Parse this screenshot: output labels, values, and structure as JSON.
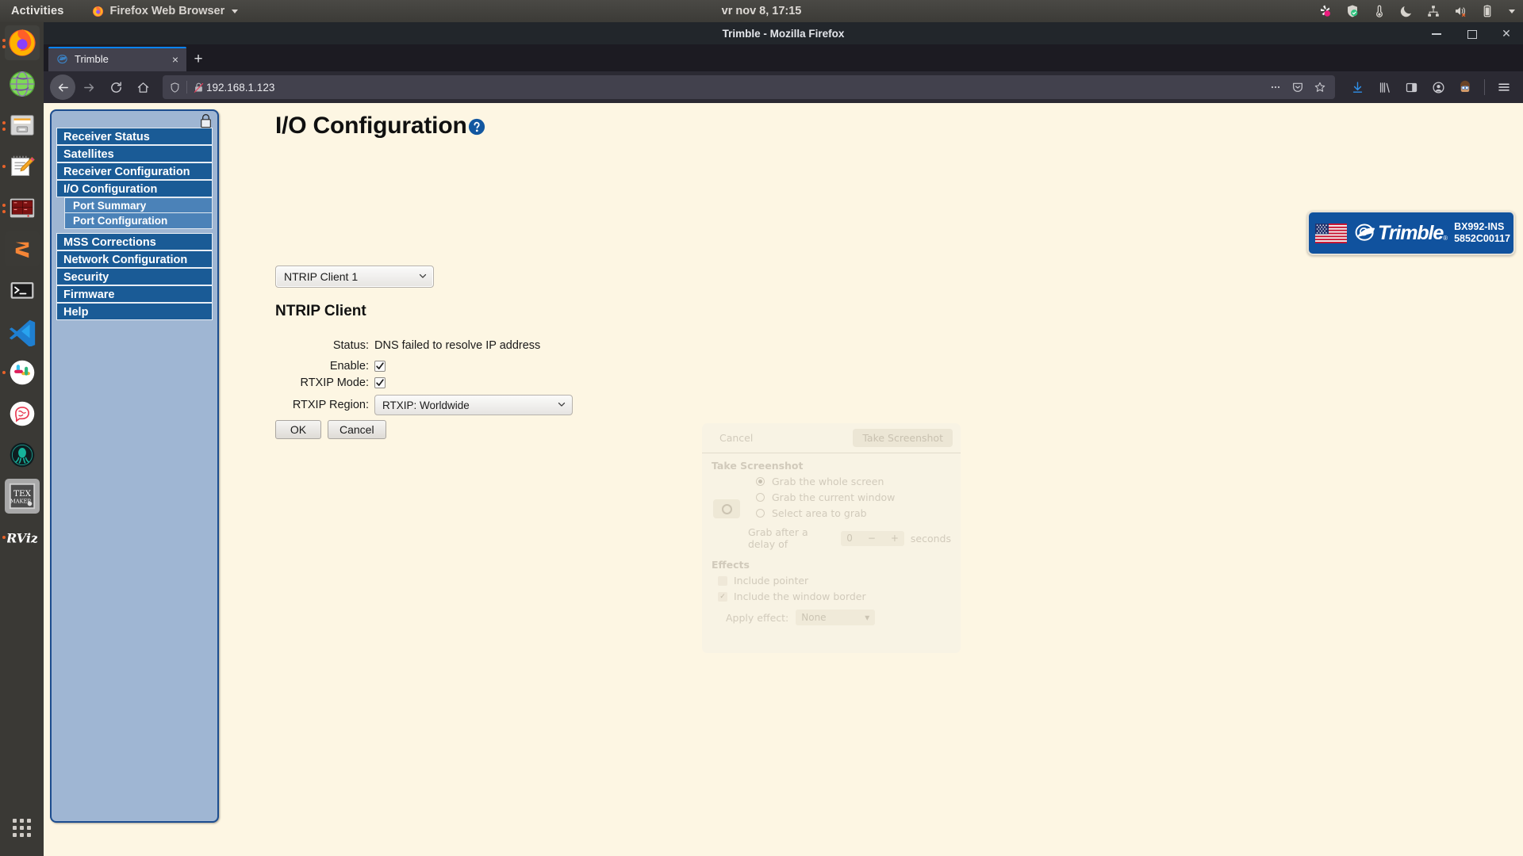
{
  "desktop": {
    "activities_label": "Activities",
    "app_menu_label": "Firefox Web Browser",
    "clock": "vr nov  8, 17:15",
    "tray_icons": [
      "screen-record-icon",
      "shield-check-icon",
      "thermometer-icon",
      "night-light-moon-icon",
      "network-wired-icon",
      "speaker-muted-icon",
      "battery-icon",
      "system-menu-caret-icon"
    ],
    "dock_items": [
      {
        "name": "firefox",
        "running": true,
        "active": true
      },
      {
        "name": "globe-browser",
        "running": false,
        "active": false
      },
      {
        "name": "file-cabinet",
        "running": true,
        "active": false
      },
      {
        "name": "notes-editor",
        "running": true,
        "active": false
      },
      {
        "name": "terminal-grid",
        "running": true,
        "active": false
      },
      {
        "name": "sublime-text",
        "running": false,
        "active": false
      },
      {
        "name": "terminal",
        "running": false,
        "active": false
      },
      {
        "name": "vs-code",
        "running": false,
        "active": false
      },
      {
        "name": "slack",
        "running": true,
        "active": false
      },
      {
        "name": "brain-chat",
        "running": false,
        "active": false
      },
      {
        "name": "squid-dark",
        "running": false,
        "active": false
      },
      {
        "name": "texmaker",
        "running": false,
        "active": false
      },
      {
        "name": "rviz",
        "running": true,
        "active": false
      }
    ],
    "apps_grid_label": "Show Applications"
  },
  "browser": {
    "window_title": "Trimble - Mozilla Firefox",
    "tab": {
      "title": "Trimble",
      "close_label": "×"
    },
    "new_tab_label": "+",
    "window_controls": {
      "minimize": "minimize",
      "maximize": "maximize",
      "close": "×"
    },
    "url": "192.168.1.123",
    "nav": {
      "back": "Back",
      "forward": "Forward",
      "reload": "Reload",
      "home": "Home"
    },
    "url_actions": [
      "page-actions-ellipsis",
      "save-to-pocket",
      "bookmark-star"
    ],
    "toolbar_end": [
      "downloads",
      "library",
      "sidebar",
      "account",
      "avatar",
      "app-menu"
    ]
  },
  "sidebar": {
    "lock_icon": "padlock-icon",
    "items": [
      {
        "label": "Receiver Status",
        "selected": false
      },
      {
        "label": "Satellites",
        "selected": false
      },
      {
        "label": "Receiver Configuration",
        "selected": false
      },
      {
        "label": "I/O Configuration",
        "selected": true
      },
      {
        "label": "MSS Corrections",
        "selected": false
      },
      {
        "label": "Network Configuration",
        "selected": false
      },
      {
        "label": "Security",
        "selected": false
      },
      {
        "label": "Firmware",
        "selected": false
      },
      {
        "label": "Help",
        "selected": false
      }
    ],
    "subitems": [
      {
        "label": "Port Summary"
      },
      {
        "label": "Port Configuration"
      }
    ]
  },
  "main": {
    "page_title": "I/O Configuration",
    "help_icon": "help-circle-icon",
    "client_select": {
      "value": "NTRIP Client 1"
    },
    "section_title": "NTRIP Client",
    "fields": {
      "status_label": "Status:",
      "status_value": "DNS failed to resolve IP address",
      "enable_label": "Enable:",
      "enable_checked": true,
      "rtxip_label": "RTXIP Mode:",
      "rtxip_checked": true,
      "region_label": "RTXIP Region:",
      "region_value": "RTXIP: Worldwide"
    },
    "buttons": {
      "ok": "OK",
      "cancel": "Cancel"
    }
  },
  "brand": {
    "flag": "us-flag-icon",
    "logo_text": "Trimble",
    "model": "BX992-INS",
    "serial": "5852C00117"
  },
  "ghost_dialog": {
    "cancel": "Cancel",
    "take": "Take Screenshot",
    "heading": "Take Screenshot",
    "options": [
      {
        "label": "Grab the whole screen",
        "selected": true
      },
      {
        "label": "Grab the current window",
        "selected": false
      },
      {
        "label": "Select area to grab",
        "selected": false
      }
    ],
    "delay_label": "Grab after a delay of",
    "delay_value": "0",
    "delay_minus": "−",
    "delay_plus": "+",
    "seconds_label": "seconds",
    "effects_heading": "Effects",
    "include_pointer": {
      "label": "Include pointer",
      "checked": false
    },
    "include_border": {
      "label": "Include the window border",
      "checked": true
    },
    "apply_effect_label": "Apply effect:",
    "apply_effect_value": "None"
  },
  "colors": {
    "nav_blue": "#1a5b96",
    "sub_blue": "#4b82b8",
    "panel_blue": "#9fb6d3",
    "page_bg": "#fdf6e3",
    "brand_blue": "#10529e",
    "accent": "#0a84ff"
  }
}
